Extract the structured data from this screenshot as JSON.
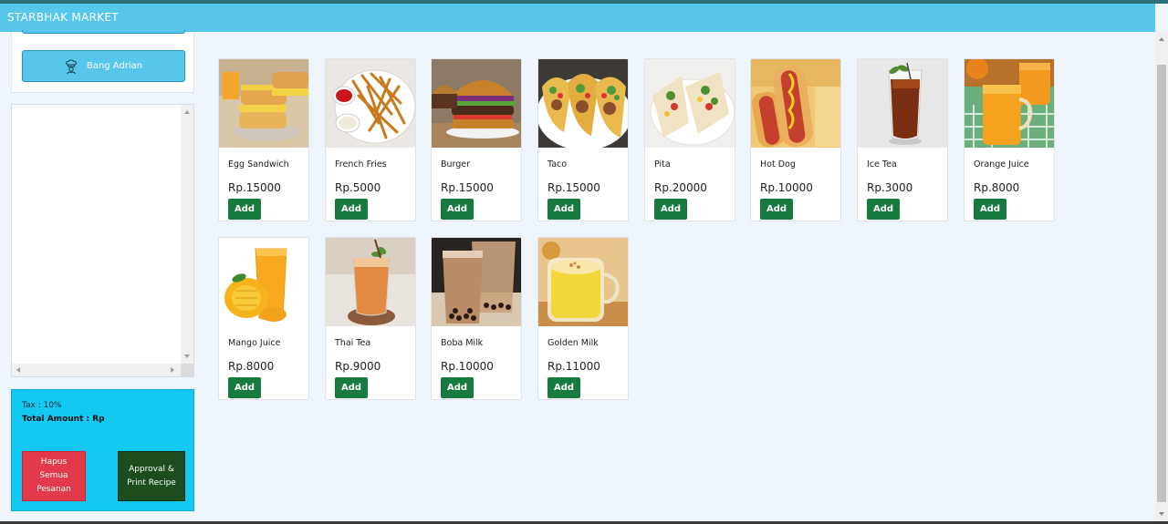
{
  "header": {
    "brand": "STARBHAK MARKET"
  },
  "sidebar": {
    "user_name": "Bang Adrian",
    "summary": {
      "tax_label": "Tax : 10%",
      "total_label": "Total Amount : Rp",
      "clear_button": "Hapus Semua Pesanan",
      "approve_button": "Approval & Print Recipe"
    }
  },
  "products": [
    {
      "name": "Egg Sandwich",
      "price": "Rp.15000",
      "add": "Add",
      "image_icon": "egg-sandwich-image"
    },
    {
      "name": "French Fries",
      "price": "Rp.5000",
      "add": "Add",
      "image_icon": "french-fries-image"
    },
    {
      "name": "Burger",
      "price": "Rp.15000",
      "add": "Add",
      "image_icon": "burger-image"
    },
    {
      "name": "Taco",
      "price": "Rp.15000",
      "add": "Add",
      "image_icon": "taco-image"
    },
    {
      "name": "Pita",
      "price": "Rp.20000",
      "add": "Add",
      "image_icon": "pita-image"
    },
    {
      "name": "Hot Dog",
      "price": "Rp.10000",
      "add": "Add",
      "image_icon": "hot-dog-image"
    },
    {
      "name": "Ice Tea",
      "price": "Rp.3000",
      "add": "Add",
      "image_icon": "ice-tea-image"
    },
    {
      "name": "Orange Juice",
      "price": "Rp.8000",
      "add": "Add",
      "image_icon": "orange-juice-image"
    },
    {
      "name": "Mango Juice",
      "price": "Rp.8000",
      "add": "Add",
      "image_icon": "mango-juice-image"
    },
    {
      "name": "Thai Tea",
      "price": "Rp.9000",
      "add": "Add",
      "image_icon": "thai-tea-image"
    },
    {
      "name": "Boba Milk",
      "price": "Rp.10000",
      "add": "Add",
      "image_icon": "boba-milk-image"
    },
    {
      "name": "Golden Milk",
      "price": "Rp.11000",
      "add": "Add",
      "image_icon": "golden-milk-image"
    }
  ],
  "colors": {
    "navbar": "#56c6ea",
    "add_button": "#177a3f",
    "clear_button": "#e23a4b",
    "approve_button": "#1b4d1e",
    "summary_panel": "#13c9f2"
  }
}
